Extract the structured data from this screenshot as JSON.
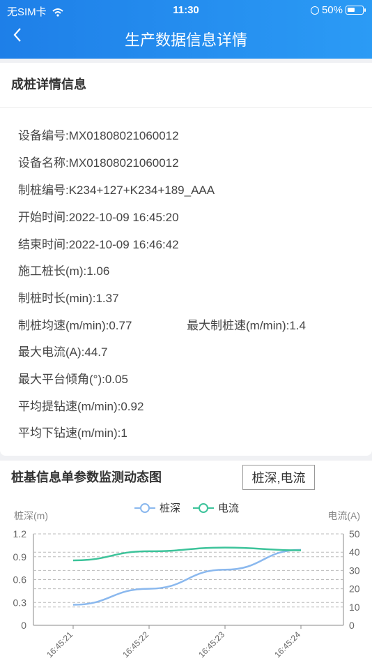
{
  "status_bar": {
    "carrier": "无SIM卡",
    "time": "11:30",
    "battery": "50%"
  },
  "nav": {
    "title": "生产数据信息详情"
  },
  "section": {
    "title": "成桩详情信息"
  },
  "details": {
    "device_no": "设备编号:MX01808021060012",
    "device_name": "设备名称:MX01808021060012",
    "pile_no": "制桩编号:K234+127+K234+189_AAA",
    "start_time": "开始时间:2022-10-09 16:45:20",
    "end_time": "结束时间:2022-10-09 16:46:42",
    "pile_length": "施工桩长(m):1.06",
    "duration": "制桩时长(min):1.37",
    "avg_speed": "制桩均速(m/min):0.77",
    "max_speed": "最大制桩速(m/min):1.4",
    "max_current": "最大电流(A):44.7",
    "max_tilt": "最大平台倾角(°):0.05",
    "avg_lift": "平均提钻速(m/min):0.92",
    "avg_down": "平均下钻速(m/min):1"
  },
  "chart_section": {
    "title": "桩基信息单参数监测动态图",
    "selector": "桩深,电流"
  },
  "chart_data": {
    "type": "line",
    "x": [
      "16:45:21",
      "16:45:22",
      "16:45:23",
      "16:45:24"
    ],
    "ylabel": "桩深(m)",
    "y2label": "电流(A)",
    "ylim": [
      0,
      1.2
    ],
    "y2lim": [
      0,
      50
    ],
    "yticks": [
      "0",
      "0.3",
      "0.6",
      "0.9",
      "1.2"
    ],
    "y2ticks": [
      "0",
      "10",
      "20",
      "30",
      "40",
      "50"
    ],
    "series": [
      {
        "name": "桩深",
        "axis": "left",
        "color": "#8ab8ee",
        "values": [
          0.27,
          0.48,
          0.73,
          0.99
        ]
      },
      {
        "name": "电流",
        "axis": "right",
        "color": "#3cc39a",
        "values": [
          35.5,
          40.5,
          42.5,
          41.0
        ]
      }
    ]
  }
}
